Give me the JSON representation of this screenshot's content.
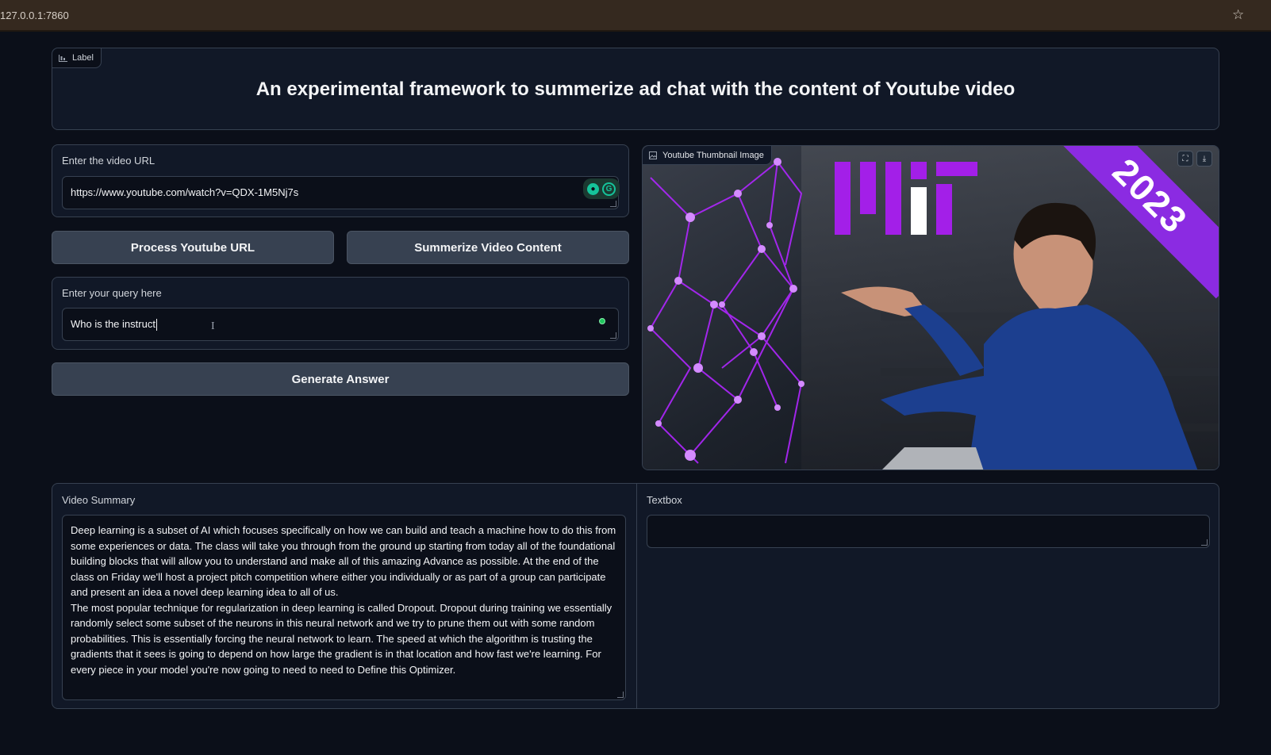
{
  "browser": {
    "url": "127.0.0.1:7860"
  },
  "header": {
    "label_chip": "Label",
    "title": "An experimental framework to summerize ad chat with the content  of Youtube video"
  },
  "url_field": {
    "label": "Enter the video URL",
    "value": "https://www.youtube.com/watch?v=QDX-1M5Nj7s"
  },
  "buttons": {
    "process": "Process Youtube URL",
    "summarize": "Summerize Video Content",
    "generate": "Generate Answer"
  },
  "query_field": {
    "label": "Enter your query here",
    "value": "Who is the instruct"
  },
  "thumbnail": {
    "label": "Youtube Thumbnail Image",
    "banner_text": "2023",
    "accent_color": "#8b2be2"
  },
  "summary": {
    "label": "Video Summary",
    "paragraphs": [
      "Deep learning is a subset of AI which focuses specifically on how we can build and teach a machine how to do this from some experiences or data. The class will take you through from the ground up starting from today all of the foundational building blocks that will allow you to understand and make all of this amazing Advance as possible. At the end of the class on Friday we'll host a project pitch competition where either you individually or as part of a group can participate and present an idea a novel deep learning idea to all of us.",
      "The most popular technique for regularization in  deep learning is called Dropout. Dropout during training we essentially randomly select some subset of the neurons in this neural network and we try to prune them out with some random probabilities. This is essentially forcing the neural network to learn. The speed at which the algorithm is trusting  the gradients that it sees is going to depend on how large the gradient is in that location and how fast we're learning. For every piece in your model you're now going to need to need to Define this Optimizer."
    ]
  },
  "textbox": {
    "label": "Textbox",
    "value": ""
  },
  "icons": {
    "star": "star-icon",
    "chart_label": "chart-icon",
    "image_label": "image-icon",
    "fullscreen": "fullscreen-icon",
    "download": "download-icon"
  }
}
